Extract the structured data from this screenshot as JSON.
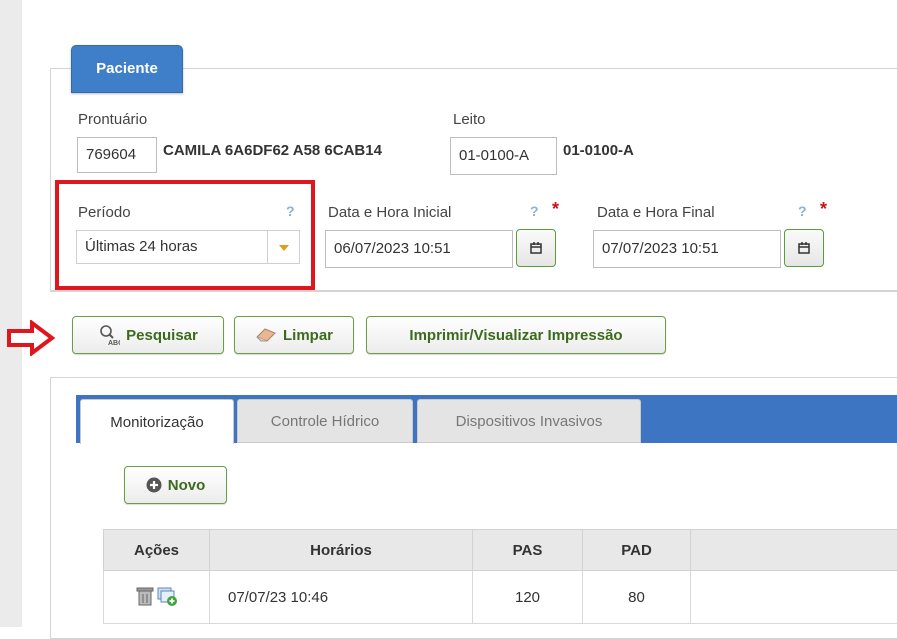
{
  "legend": "Paciente",
  "patient": {
    "prontuario_label": "Prontuário",
    "prontuario_value": "769604",
    "name": "CAMILA 6A6DF62 A58 6CAB14",
    "leito_label": "Leito",
    "leito_value": "01-0100-A",
    "leito_display": "01-0100-A"
  },
  "periodo": {
    "label": "Período",
    "help": "?",
    "value": "Últimas 24 horas"
  },
  "inicial": {
    "label": "Data e Hora Inicial",
    "help": "?",
    "required": "*",
    "value": "06/07/2023 10:51",
    "icon": "calendar-icon"
  },
  "final": {
    "label": "Data e Hora Final",
    "help": "?",
    "required": "*",
    "value": "07/07/2023 10:51",
    "icon": "calendar-icon"
  },
  "actions": {
    "pesquisar": "Pesquisar",
    "limpar": "Limpar",
    "imprimir": "Imprimir/Visualizar Impressão"
  },
  "tabs": [
    {
      "label": "Monitorização",
      "active": true
    },
    {
      "label": "Controle Hídrico",
      "active": false
    },
    {
      "label": "Dispositivos Invasivos",
      "active": false
    }
  ],
  "novo": "Novo",
  "table": {
    "headers": [
      "Ações",
      "Horários",
      "PAS",
      "PAD"
    ],
    "rows": [
      {
        "horario": "07/07/23 10:46",
        "pas": "120",
        "pad": "80"
      }
    ]
  },
  "colors": {
    "primary": "#3f7fc9",
    "highlight": "#e0161e",
    "button_text": "#3d6b1d"
  }
}
